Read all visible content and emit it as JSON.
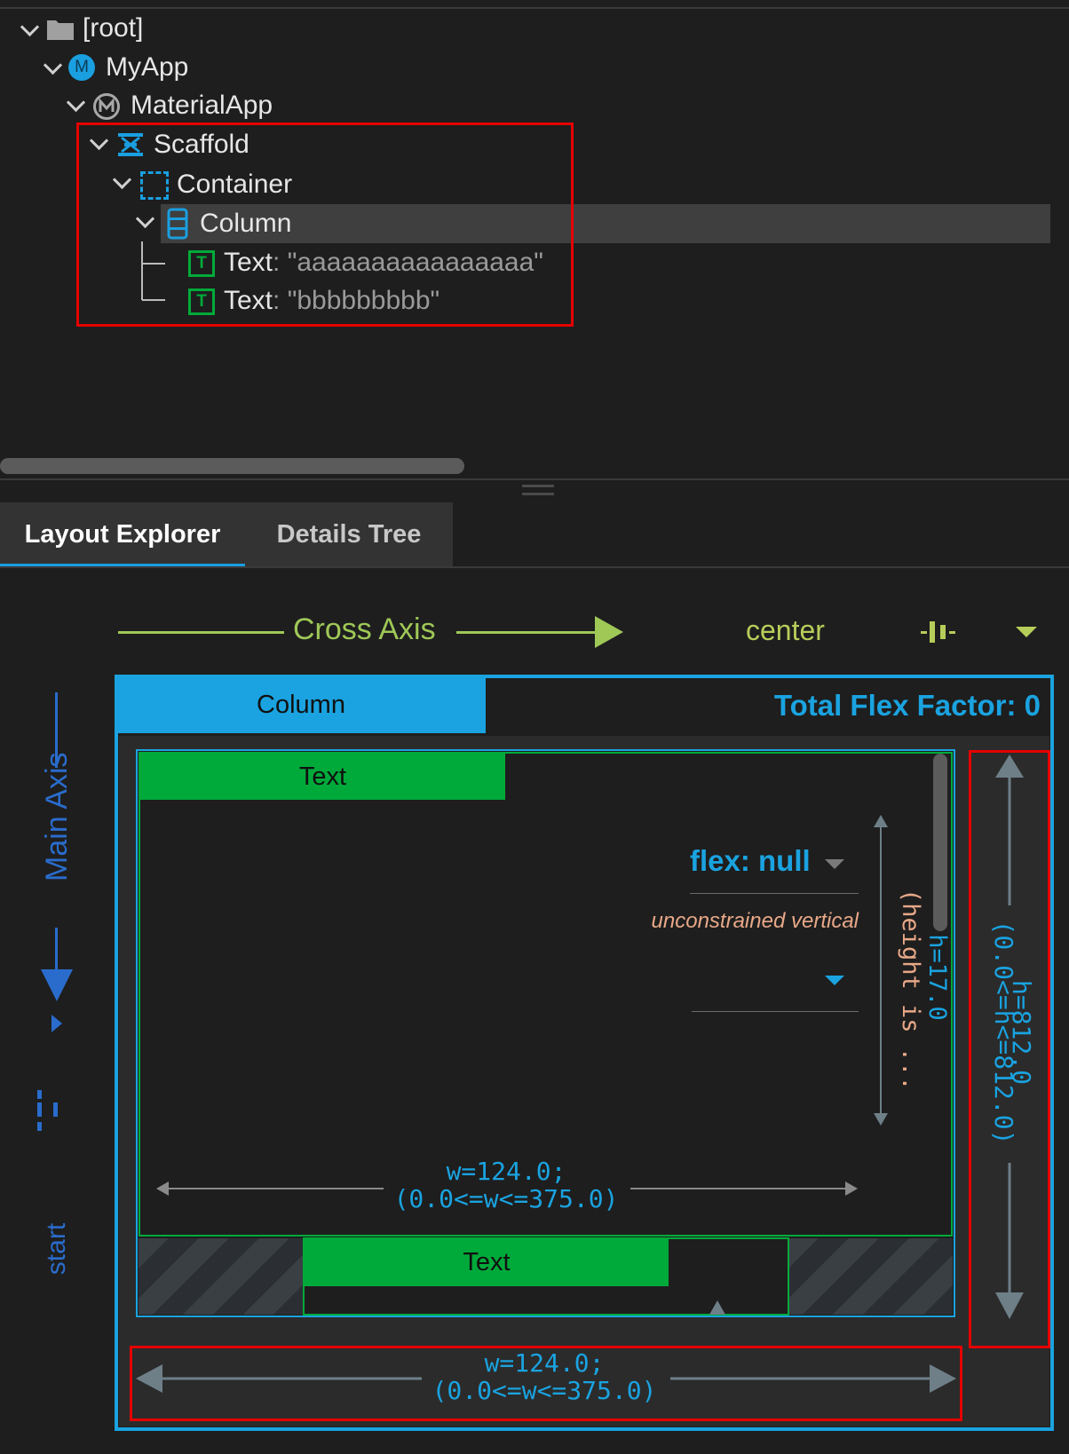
{
  "tree": {
    "root": "[root]",
    "myapp": "MyApp",
    "myapp_badge": "M",
    "materialapp": "MaterialApp",
    "scaffold": "Scaffold",
    "container": "Container",
    "column": "Column",
    "text1_label": "Text",
    "text1_value": ": \"aaaaaaaaaaaaaaaa\"",
    "text2_label": "Text",
    "text2_value": ": \"bbbbbbbbb\""
  },
  "tabs": {
    "layout_explorer": "Layout Explorer",
    "details_tree": "Details Tree"
  },
  "layout": {
    "cross_axis_label": "Cross Axis",
    "cross_axis_value": "center",
    "main_axis_label": "Main Axis",
    "main_axis_value": "start",
    "column_label": "Column",
    "total_flex": "Total Flex Factor: 0",
    "child1_label": "Text",
    "child2_label": "Text",
    "flex_label": "flex: null",
    "unconstrained": "unconstrained vertical",
    "inner_height": "h=17.0",
    "inner_height_note": "(height is ...",
    "inner_width_1": "w=124.0;",
    "inner_width_2": "(0.0<=w<=375.0)",
    "outer_height_1": "h=812.0",
    "outer_height_2": "(0.0<=h<=812.0)",
    "outer_width_1": "w=124.0;",
    "outer_width_2": "(0.0<=w<=375.0)"
  },
  "colors": {
    "accent_blue": "#1aa3e0",
    "text_green": "#00aa3a",
    "axis_green": "#9fc857",
    "highlight_red": "#e60000"
  }
}
